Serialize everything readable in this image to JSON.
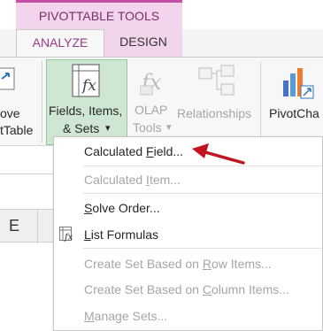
{
  "ribbon": {
    "context_tab_title": "PIVOTTABLE TOOLS",
    "tabs": [
      {
        "label": "ANALYZE",
        "active": true
      },
      {
        "label": "DESIGN",
        "active": false
      }
    ],
    "left_partial": {
      "line1": "ove",
      "line2": "tTable"
    },
    "fields_items_sets": {
      "line1": "Fields, Items,",
      "line2": "& Sets",
      "dropdown": "▾"
    },
    "olap_tools": {
      "line1": "OLAP",
      "line2": "Tools",
      "dropdown": "▾"
    },
    "relationships": {
      "label": "Relationships"
    },
    "pivotchart": {
      "label": "PivotCha"
    }
  },
  "sheet": {
    "column_header": "E"
  },
  "menu": {
    "items": [
      {
        "pre": "Calculated ",
        "key": "F",
        "post": "ield...",
        "enabled": true,
        "icon": null
      },
      {
        "pre": "Calculated ",
        "key": "I",
        "post": "tem...",
        "enabled": false,
        "icon": null
      },
      {
        "pre": "",
        "key": "S",
        "post": "olve Order...",
        "enabled": true,
        "icon": null
      },
      {
        "pre": "",
        "key": "L",
        "post": "ist Formulas",
        "enabled": true,
        "icon": "list-formulas-icon"
      },
      {
        "pre": "Create Set Based on ",
        "key": "R",
        "post": "ow Items...",
        "enabled": false,
        "icon": null
      },
      {
        "pre": "Create Set Based on ",
        "key": "C",
        "post": "olumn Items...",
        "enabled": false,
        "icon": null
      },
      {
        "pre": "",
        "key": "M",
        "post": "anage Sets...",
        "enabled": false,
        "icon": null
      }
    ]
  },
  "colors": {
    "context_accent": "#c64fa6",
    "context_fill": "#f2d4ec",
    "active_tab_text": "#9a3b84",
    "button_highlight": "#cfe6d2",
    "annotation_arrow": "#c0151f"
  }
}
